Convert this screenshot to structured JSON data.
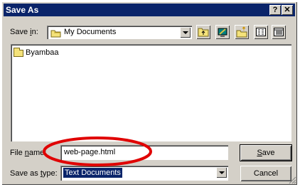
{
  "window": {
    "title": "Save As",
    "help_label": "?",
    "close_label": "✕"
  },
  "savein": {
    "label_pre": "Save ",
    "label_key": "i",
    "label_post": "n:",
    "value": "My Documents"
  },
  "toolbar": {
    "buttons": [
      "up-one-level",
      "desktop",
      "create-new-folder",
      "list-view",
      "details-view"
    ]
  },
  "files": [
    {
      "name": "Byambaa",
      "type": "folder"
    }
  ],
  "filename": {
    "label_pre": "File ",
    "label_key": "n",
    "label_post": "ame:",
    "value": "web-page.html"
  },
  "savetype": {
    "label_pre": "Save as ",
    "label_key": "t",
    "label_post": "ype:",
    "value": "Text Documents"
  },
  "buttons": {
    "save_key": "S",
    "save_rest": "ave",
    "cancel": "Cancel"
  },
  "annotation": {
    "color": "#e00000"
  },
  "colors": {
    "titlebar": "#0a246a",
    "selection": "#0a246a",
    "face": "#d4d0c8"
  }
}
